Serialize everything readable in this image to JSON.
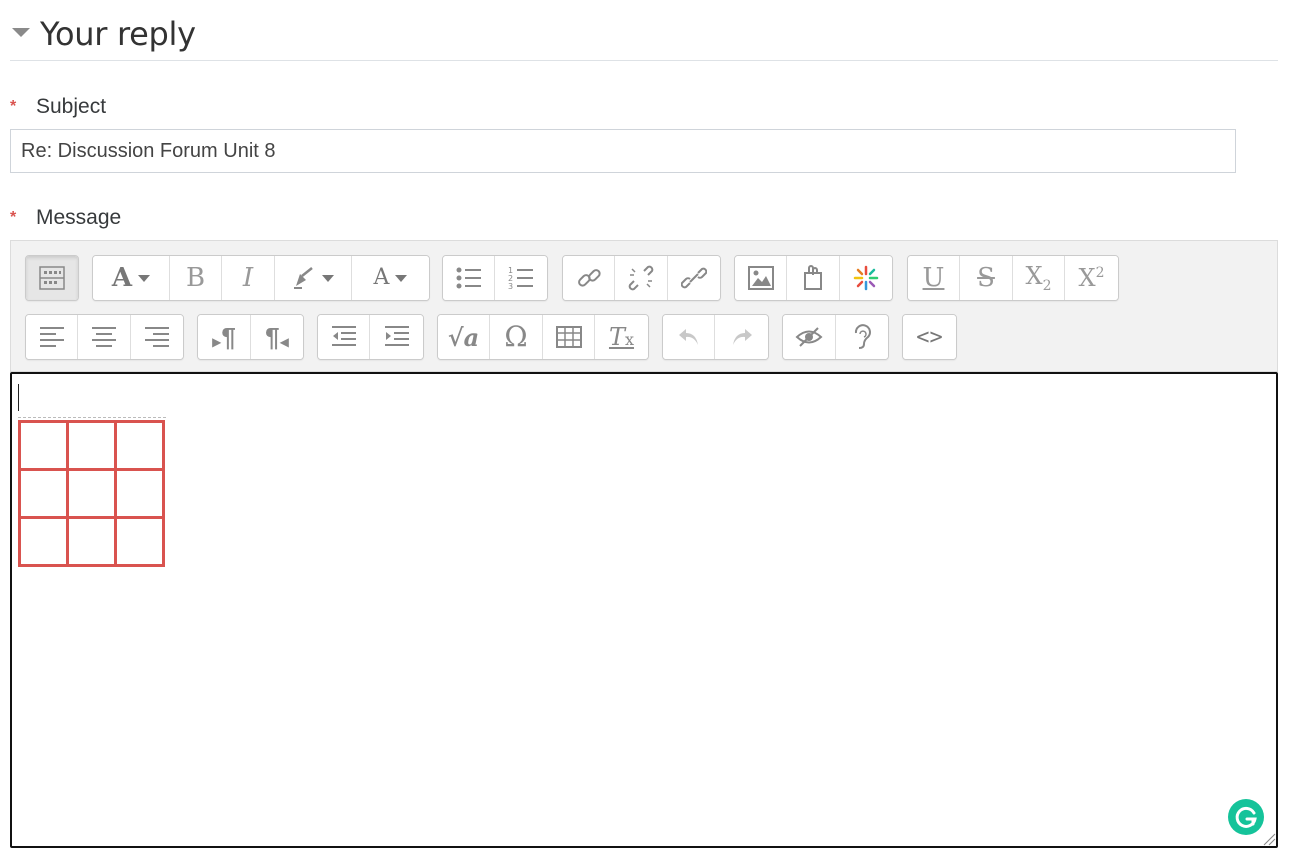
{
  "section": {
    "title": "Your reply"
  },
  "subject": {
    "label": "Subject",
    "required_marker": "*",
    "value": "Re: Discussion Forum Unit 8"
  },
  "message": {
    "label": "Message",
    "required_marker": "*"
  },
  "toolbar": {
    "row1": [
      [
        "toggle-toolbar-icon"
      ],
      [
        "font-family-icon",
        "bold-icon",
        "italic-icon",
        "highlight-color-icon",
        "text-color-icon"
      ],
      [
        "bulleted-list-icon",
        "numbered-list-icon"
      ],
      [
        "link-icon",
        "unlink-icon",
        "manage-links-icon"
      ],
      [
        "image-icon",
        "media-icon",
        "h5p-icon"
      ],
      [
        "underline-icon",
        "strikethrough-icon",
        "subscript-icon",
        "superscript-icon"
      ]
    ],
    "row2": [
      [
        "align-left-icon",
        "align-center-icon",
        "align-right-icon"
      ],
      [
        "ltr-icon",
        "rtl-icon"
      ],
      [
        "outdent-icon",
        "indent-icon"
      ],
      [
        "equation-icon",
        "special-character-icon",
        "table-icon",
        "clear-formatting-icon"
      ],
      [
        "undo-icon",
        "redo-icon"
      ],
      [
        "accessibility-checker-icon",
        "screenreader-helper-icon"
      ],
      [
        "html-source-icon"
      ]
    ],
    "glyphs": {
      "bold": "B",
      "italic": "I",
      "font": "A",
      "text_color": "A",
      "underline": "U",
      "strike": "S",
      "sub": "X",
      "sub_2": "2",
      "sup": "X",
      "sup_2": "2",
      "ltr": "¶",
      "rtl": "¶",
      "omega": "Ω",
      "sqrt_a": "a",
      "clear_t": "T",
      "clear_x": "x",
      "source": "<>"
    }
  },
  "editor": {
    "table": {
      "rows": 3,
      "cols": 3,
      "border_color": "#d9534f"
    }
  },
  "colors": {
    "required": "#d9534f",
    "grammarly": "#15c39a",
    "accent_border": "#111111"
  }
}
